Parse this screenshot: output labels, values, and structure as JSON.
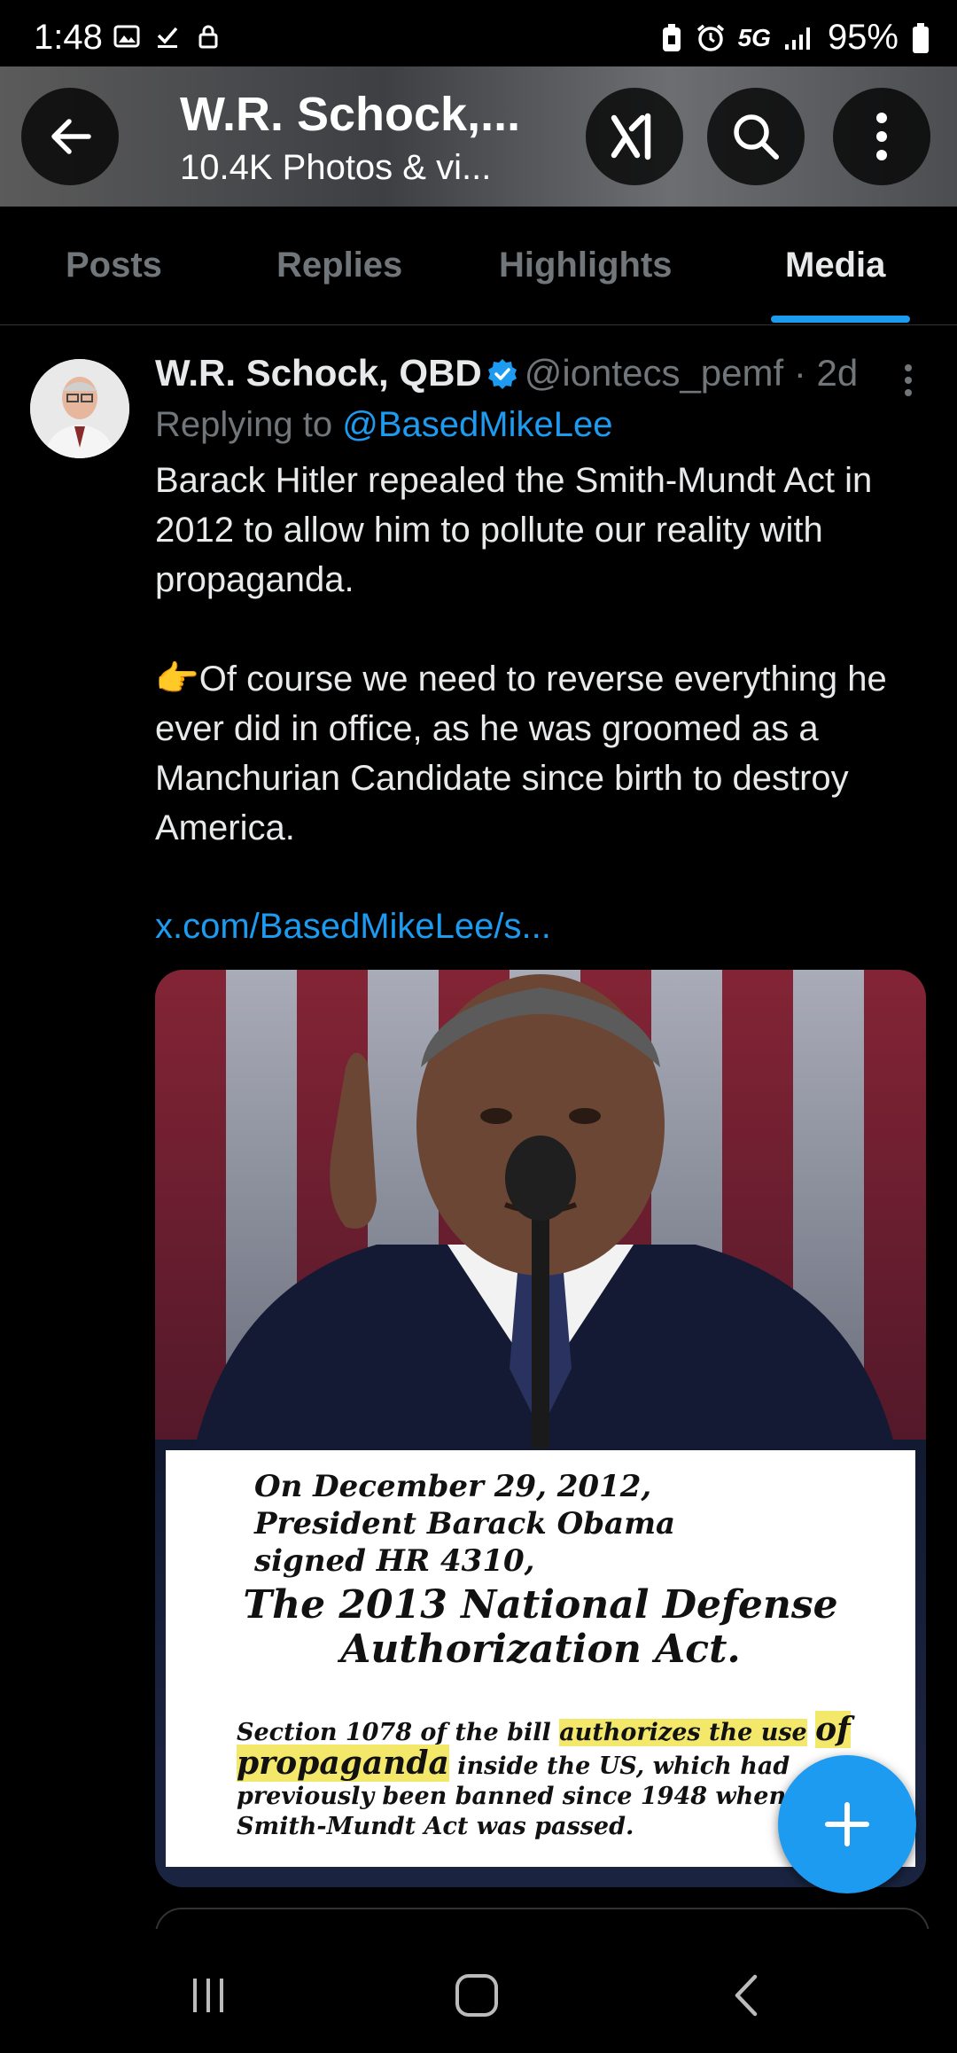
{
  "status_bar": {
    "time": "1:48",
    "network": "5G",
    "battery": "95%"
  },
  "header": {
    "title": "W.R. Schock,...",
    "subtitle": "10.4K Photos & vi..."
  },
  "tabs": [
    {
      "label": "Posts",
      "active": false
    },
    {
      "label": "Replies",
      "active": false
    },
    {
      "label": "Highlights",
      "active": false
    },
    {
      "label": "Media",
      "active": true
    }
  ],
  "post": {
    "author_name": "W.R. Schock, QBD",
    "handle": "@iontecs_pemf",
    "time_ago": "· 2d",
    "replying_prefix": "Replying to ",
    "replying_to": "@BasedMikeLee",
    "text": "Barack Hitler repealed the Smith-Mundt Act in 2012 to allow him to pollute our reality with propaganda.\n\n👉Of course we need to reverse everything he ever did in office, as he was groomed as a Manchurian Candidate since birth to destroy America.",
    "link": "x.com/BasedMikeLee/s...",
    "image": {
      "caption_line1": "On December 29, 2012,\nPresident Barack Obama\nsigned HR 4310,",
      "caption_line2": "The 2013 National Defense\nAuthorization Act.",
      "section_pre": "Section 1078 of the bill ",
      "section_highlight1": "authorizes the use",
      "section_highlight2": "of propaganda",
      "section_post": " inside the US, which had previously been banned since 1948 when the Smith-Mundt Act was passed."
    }
  },
  "colors": {
    "accent": "#1d9bf0",
    "muted": "#71767b",
    "text": "#e7e9ea"
  }
}
